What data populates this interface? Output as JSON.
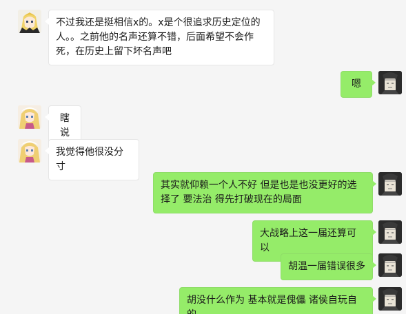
{
  "messages": [
    {
      "side": "left",
      "avatar": "avatar-a",
      "text": "不过我还是挺相信x的。x是个很追求历史定位的人。。之前他的名声还算不错，后面希望不会作死，在历史上留下坏名声吧"
    },
    {
      "side": "right",
      "avatar": "avatar-self",
      "text": "嗯"
    },
    {
      "side": "left",
      "avatar": "avatar-b",
      "text": "瞎说"
    },
    {
      "side": "left",
      "avatar": "avatar-b",
      "text": "我觉得他很没分寸"
    },
    {
      "side": "right",
      "avatar": "avatar-self",
      "text": "其实就仰赖一个人不好 但是也是也没更好的选择了 要法治 得先打破现在的局面"
    },
    {
      "side": "right",
      "avatar": "avatar-self",
      "text": "大战略上这一届还算可以"
    },
    {
      "side": "right",
      "avatar": "avatar-self",
      "text": "胡温一届错误很多"
    },
    {
      "side": "right",
      "avatar": "avatar-self",
      "text": "胡没什么作为 基本就是傀儡 诸侯自玩自的"
    }
  ],
  "colors": {
    "background": "#f5f5f5",
    "left_bubble": "#ffffff",
    "right_bubble": "#95ec69"
  }
}
